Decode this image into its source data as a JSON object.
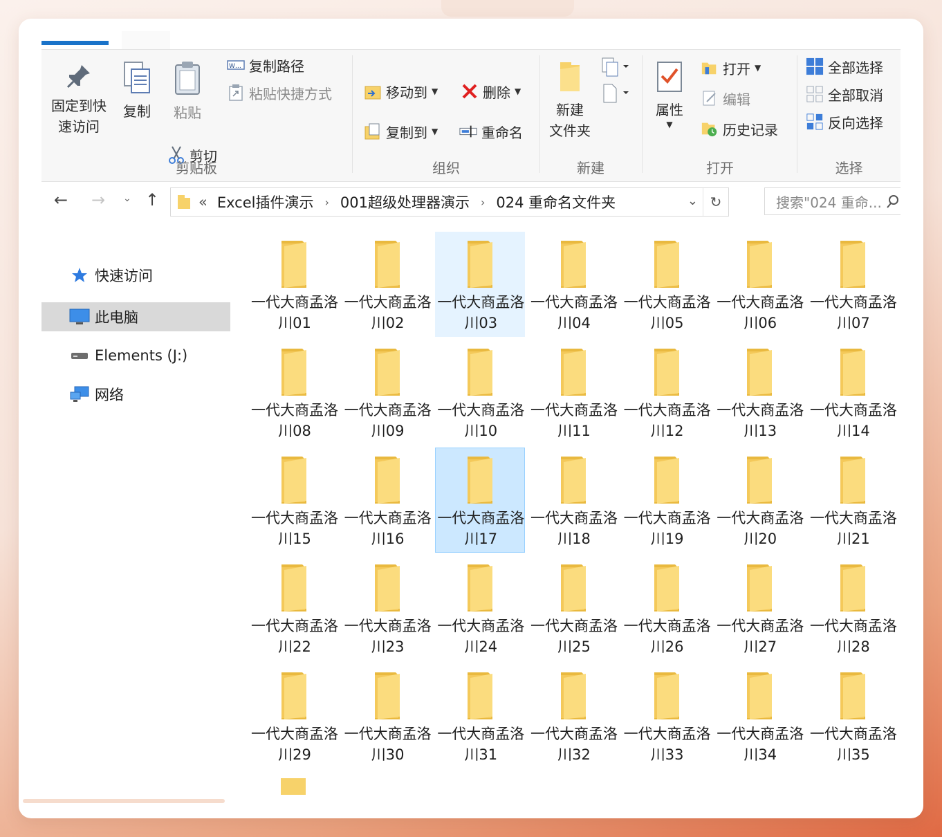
{
  "ribbon": {
    "clipboard": {
      "group_label": "剪贴板",
      "pin_label": "固定到快\n速访问",
      "copy_label": "复制",
      "paste_label": "粘贴",
      "copy_path_label": "复制路径",
      "paste_shortcut_label": "粘贴快捷方式",
      "cut_label": "剪切"
    },
    "organize": {
      "group_label": "组织",
      "move_to_label": "移动到",
      "copy_to_label": "复制到",
      "delete_label": "删除",
      "rename_label": "重命名"
    },
    "new": {
      "group_label": "新建",
      "new_folder_label": "新建\n文件夹"
    },
    "open": {
      "group_label": "打开",
      "properties_label": "属性",
      "open_label": "打开",
      "edit_label": "编辑",
      "history_label": "历史记录"
    },
    "select": {
      "group_label": "选择",
      "select_all_label": "全部选择",
      "select_none_label": "全部取消",
      "invert_label": "反向选择"
    }
  },
  "address": {
    "overflow": "«",
    "crumbs": [
      "Excel插件演示",
      "001超级处理器演示",
      "024 重命名文件夹"
    ],
    "separator": "›"
  },
  "search": {
    "placeholder": "搜索\"024 重命..."
  },
  "nav": {
    "quick_access": "快速访问",
    "this_pc": "此电脑",
    "drive": "Elements (J:)",
    "network": "网络"
  },
  "folders": [
    "一代大商孟洛川01",
    "一代大商孟洛川02",
    "一代大商孟洛川03",
    "一代大商孟洛川04",
    "一代大商孟洛川05",
    "一代大商孟洛川06",
    "一代大商孟洛川07",
    "一代大商孟洛川08",
    "一代大商孟洛川09",
    "一代大商孟洛川10",
    "一代大商孟洛川11",
    "一代大商孟洛川12",
    "一代大商孟洛川13",
    "一代大商孟洛川14",
    "一代大商孟洛川15",
    "一代大商孟洛川16",
    "一代大商孟洛川17",
    "一代大商孟洛川18",
    "一代大商孟洛川19",
    "一代大商孟洛川20",
    "一代大商孟洛川21",
    "一代大商孟洛川22",
    "一代大商孟洛川23",
    "一代大商孟洛川24",
    "一代大商孟洛川25",
    "一代大商孟洛川26",
    "一代大商孟洛川27",
    "一代大商孟洛川28",
    "一代大商孟洛川29",
    "一代大商孟洛川30",
    "一代大商孟洛川31",
    "一代大商孟洛川32",
    "一代大商孟洛川33",
    "一代大商孟洛川34",
    "一代大商孟洛川35"
  ],
  "hover_index": 2,
  "selected_index": 16,
  "colors": {
    "accent": "#1a73c9",
    "folder": "#f7d26a",
    "selection": "#cce8ff"
  }
}
